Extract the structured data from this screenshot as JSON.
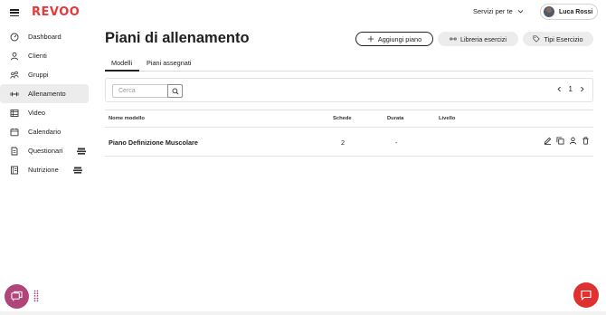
{
  "app": {
    "logo": "REVOO"
  },
  "header": {
    "services_label": "Servizi per te",
    "user_name": "Luca Rossi"
  },
  "sidebar": {
    "items": [
      {
        "label": "Dashboard",
        "icon": "gauge-icon"
      },
      {
        "label": "Clienti",
        "icon": "user-icon"
      },
      {
        "label": "Gruppi",
        "icon": "group-icon"
      },
      {
        "label": "Allenamento",
        "icon": "dumbbell-icon",
        "active": true
      },
      {
        "label": "Video",
        "icon": "film-icon"
      },
      {
        "label": "Calendario",
        "icon": "calendar-icon"
      },
      {
        "label": "Questionari",
        "icon": "document-icon",
        "badge": "stack-icon"
      },
      {
        "label": "Nutrizione",
        "icon": "notebook-icon",
        "badge": "stack-icon"
      }
    ]
  },
  "main": {
    "title": "Piani di allenamento",
    "buttons": {
      "add": "Aggiungi piano",
      "library": "Libreria esercizi",
      "types": "Tipi Esercizio"
    },
    "tabs": [
      "Modelli",
      "Piani assegnati"
    ],
    "search": {
      "placeholder": "Cerca"
    },
    "pager": {
      "page": "1"
    },
    "table": {
      "headers": {
        "name": "Nome modello",
        "schede": "Schede",
        "durata": "Durata",
        "livello": "Livello"
      },
      "rows": [
        {
          "name": "Piano Definizione Muscolare",
          "schede": "2",
          "durata": "-",
          "livello": ""
        }
      ]
    }
  },
  "colors": {
    "brand": "#e8383d",
    "chat_fab": "#b0457c",
    "support_fab": "#e03131"
  }
}
